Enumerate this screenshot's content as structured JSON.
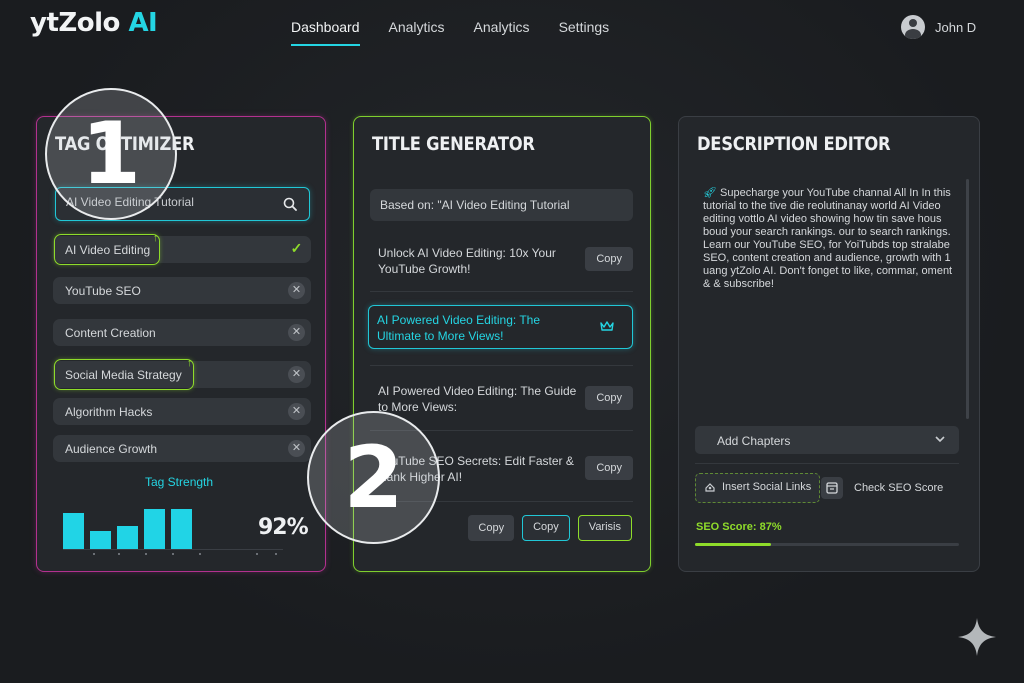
{
  "header": {
    "logo_main": "ytZolo",
    "logo_ai": "AI",
    "nav": [
      "Dashboard",
      "Analytics",
      "Analytics",
      "Settings"
    ],
    "user_name": "John D"
  },
  "tag_optimizer": {
    "title": "TAG OPTIMIZER",
    "search_value": "AI Video Editing Tutorial",
    "tags": [
      {
        "label": "AI Video Editing",
        "state": "highlighted"
      },
      {
        "label": "YouTube SEO",
        "state": "normal"
      },
      {
        "label": "Content Creation",
        "state": "normal"
      },
      {
        "label": "Social Media Strategy",
        "state": "highlighted"
      },
      {
        "label": "Algorithm Hacks",
        "state": "normal"
      },
      {
        "label": "Audience Growth",
        "state": "normal"
      }
    ],
    "strength_label": "Tag Strength",
    "strength_bars": [
      0.82,
      0.42,
      0.52,
      0.9,
      0.92
    ],
    "strength_value": "92%"
  },
  "title_generator": {
    "title": "TITLE GENERATOR",
    "based_on": "Based on: \"AI Video Editing Tutorial",
    "suggestions": [
      "Unlock AI Video Editing: 10x Your YouTube Growth!",
      "AI Powered Video Editing: The Ultimate to More Views!",
      "AI Powered Video Editing: The Guide to More Views:",
      "YouTube SEO Secrets: Edit Faster & Rank Higher AI!"
    ],
    "copy_label": "Copy",
    "bottom_buttons": [
      "Copy",
      "Copy",
      "Varisis"
    ]
  },
  "description_editor": {
    "title": "DESCRIPTION EDITOR",
    "body": "Supecharge your YouTube channal All In In this tutorial to the tive die reolutinanay world AI Video editing vottlo AI video showing how tin save hous boud your search rankings. our to search rankings. Learn our YouTube SEO, for YoiTubds top stralabe SEO, content creation and audience, growth with 1 uang ytZolo AI. Don't fonget to like, commar, oment & & subscribe!",
    "chapters_label": "Add Chapters",
    "social_links_label": "Insert Social Links",
    "check_seo_label": "Check SEO Score",
    "seo_score_label": "SEO Score: 87%",
    "seo_score_fraction": 0.87
  },
  "overlays": {
    "step_1": "1",
    "step_2": "2"
  },
  "colors": {
    "accent_cyan": "#24d5e3",
    "accent_green": "#8fdc2a",
    "accent_magenta": "#b3318f"
  }
}
